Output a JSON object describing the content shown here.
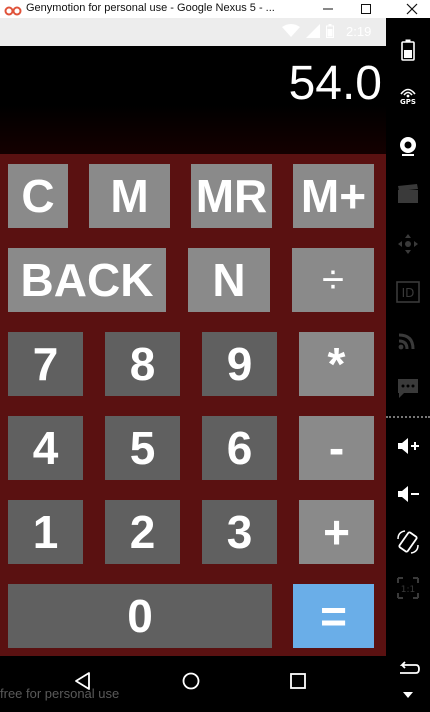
{
  "window": {
    "title": "Genymotion for personal use - Google Nexus 5 - ..."
  },
  "statusbar": {
    "time": "2:19"
  },
  "display": {
    "value": "54.0"
  },
  "keys": {
    "c": "C",
    "m": "M",
    "mr": "MR",
    "mplus": "M+",
    "back": "BACK",
    "n": "N",
    "divide": "÷",
    "seven": "7",
    "eight": "8",
    "nine": "9",
    "multiply": "*",
    "four": "4",
    "five": "5",
    "six": "6",
    "minus": "-",
    "one": "1",
    "two": "2",
    "three": "3",
    "plus": "+",
    "zero": "0",
    "equals": "="
  },
  "watermark": "free for personal use",
  "toolbar": {
    "gps_label": "GPS",
    "id_label": "ID",
    "pixel_perfect_label": "1:1"
  },
  "colors": {
    "keypad_bg": "#5a1111",
    "key_light": "#8a8a8a",
    "key_dark": "#606060",
    "equals": "#6aaee8"
  }
}
